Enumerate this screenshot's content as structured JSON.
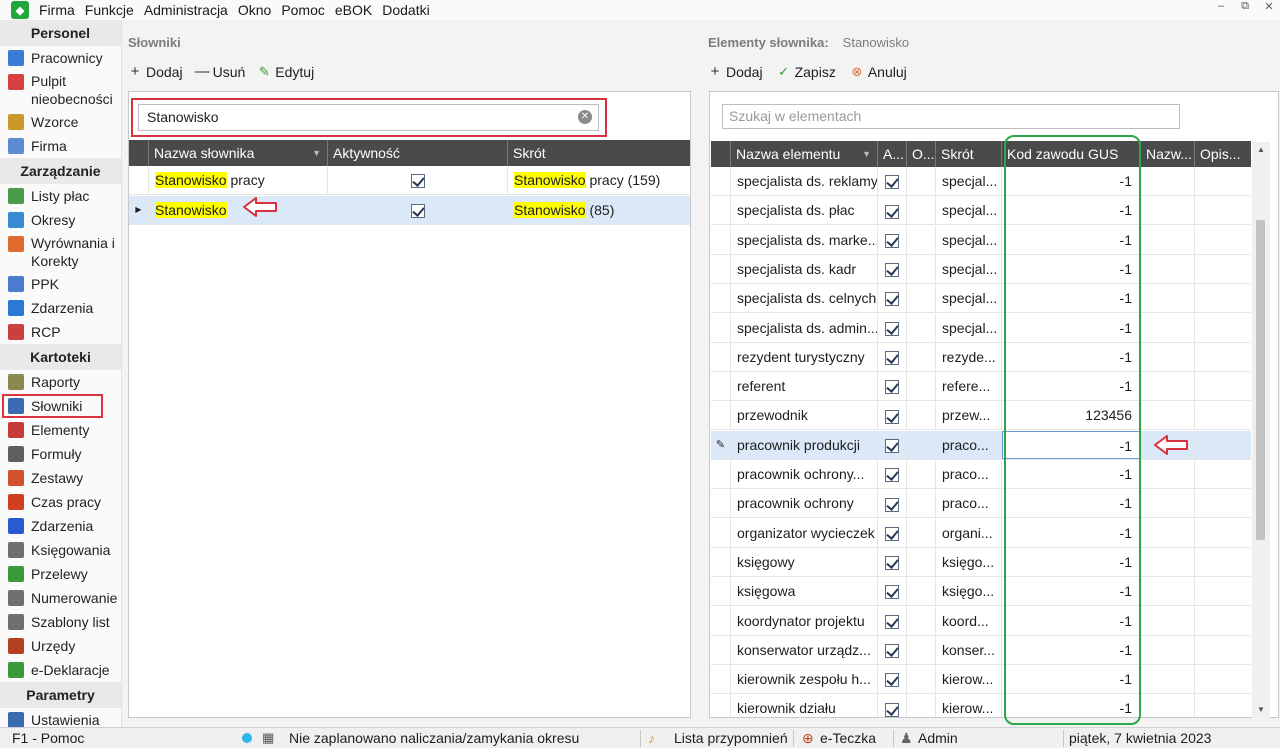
{
  "menu": [
    "Firma",
    "Funkcje",
    "Administracja",
    "Okno",
    "Pomoc",
    "eBOK",
    "Dodatki"
  ],
  "window_controls": [
    "‒",
    "⧉",
    "✕"
  ],
  "sidebar": {
    "sections": [
      {
        "title": "Personel",
        "items": [
          {
            "label": "Pracownicy",
            "icon": "user-icon",
            "color": "#3a7bd5"
          },
          {
            "label": "Pulpit nieobecności",
            "icon": "calendar-icon",
            "color": "#d94040",
            "two": true
          },
          {
            "label": "Wzorce",
            "icon": "template-icon",
            "color": "#c8982a"
          },
          {
            "label": "Firma",
            "icon": "document-icon",
            "color": "#5b8bd0"
          }
        ]
      },
      {
        "title": "Zarządzanie",
        "items": [
          {
            "label": "Listy płac",
            "icon": "payroll-icon",
            "color": "#4a9a4a"
          },
          {
            "label": "Okresy",
            "icon": "periods-icon",
            "color": "#3a8bd5"
          },
          {
            "label": "Wyrównania i Korekty",
            "icon": "corrections-icon",
            "color": "#e06a2a",
            "two": true
          },
          {
            "label": "PPK",
            "icon": "chart-icon",
            "color": "#4a7bd0"
          },
          {
            "label": "Zdarzenia",
            "icon": "globe-icon",
            "color": "#2a7ad5"
          },
          {
            "label": "RCP",
            "icon": "clock-card-icon",
            "color": "#c84040"
          }
        ]
      },
      {
        "title": "Kartoteki",
        "items": [
          {
            "label": "Raporty",
            "icon": "report-icon",
            "color": "#8a8a50"
          },
          {
            "label": "Słowniki",
            "icon": "dictionary-icon",
            "color": "#3a6ab0",
            "selected": true
          },
          {
            "label": "Elementy",
            "icon": "elements-icon",
            "color": "#c83a3a"
          },
          {
            "label": "Formuły",
            "icon": "sigma-icon",
            "color": "#606060"
          },
          {
            "label": "Zestawy",
            "icon": "sets-icon",
            "color": "#d05030"
          },
          {
            "label": "Czas pracy",
            "icon": "alarm-clock-icon",
            "color": "#d04020"
          },
          {
            "label": "Zdarzenia",
            "icon": "info-icon",
            "color": "#2a5ad0"
          },
          {
            "label": "Księgowania",
            "icon": "ledger-icon",
            "color": "#707070"
          },
          {
            "label": "Przelewy",
            "icon": "transfer-icon",
            "color": "#3a9a3a"
          },
          {
            "label": "Numerowanie",
            "icon": "numbering-icon",
            "color": "#707070"
          },
          {
            "label": "Szablony list",
            "icon": "list-template-icon",
            "color": "#707070"
          },
          {
            "label": "Urzędy",
            "icon": "building-icon",
            "color": "#b04020"
          },
          {
            "label": "e-Deklaracje",
            "icon": "e-declaration-icon",
            "color": "#3a9a3a"
          }
        ]
      },
      {
        "title": "Parametry",
        "items": [
          {
            "label": "Ustawienia",
            "icon": "settings-icon",
            "color": "#3a6ab0"
          }
        ]
      }
    ]
  },
  "left": {
    "title": "Słowniki",
    "toolbar": {
      "add": "Dodaj",
      "remove": "Usuń",
      "edit": "Edytuj"
    },
    "search_value": "Stanowisko",
    "headers": [
      "Nazwa słownika",
      "Aktywność",
      "Skrót"
    ],
    "rows": [
      {
        "name_hl": "Stanowisko",
        "name_rest": " pracy",
        "active": true,
        "abbr_hl": "Stanowisko",
        "abbr_rest": " pracy (159)",
        "selected": false
      },
      {
        "name_hl": "Stanowisko",
        "name_rest": "",
        "active": true,
        "abbr_hl": "Stanowisko",
        "abbr_rest": " (85)",
        "selected": true
      }
    ]
  },
  "right": {
    "title": "Elementy słownika:",
    "title_value": "Stanowisko",
    "toolbar": {
      "add": "Dodaj",
      "save": "Zapisz",
      "cancel": "Anuluj"
    },
    "search_placeholder": "Szukaj w elementach",
    "headers": [
      "Nazwa elementu",
      "A...",
      "O...",
      "Skrót",
      "Kod zawodu GUS",
      "Nazw...",
      "Opis..."
    ],
    "rows": [
      {
        "name": "specjalista ds. reklamy",
        "abbr": "specjal...",
        "gus": "-1"
      },
      {
        "name": "specjalista ds. płac",
        "abbr": "specjal...",
        "gus": "-1"
      },
      {
        "name": "specjalista ds. marke...",
        "abbr": "specjal...",
        "gus": "-1"
      },
      {
        "name": "specjalista ds. kadr",
        "abbr": "specjal...",
        "gus": "-1"
      },
      {
        "name": "specjalista ds. celnych",
        "abbr": "specjal...",
        "gus": "-1"
      },
      {
        "name": "specjalista ds. admin...",
        "abbr": "specjal...",
        "gus": "-1"
      },
      {
        "name": "rezydent turystyczny",
        "abbr": "rezyde...",
        "gus": "-1"
      },
      {
        "name": "referent",
        "abbr": "refere...",
        "gus": "-1"
      },
      {
        "name": "przewodnik",
        "abbr": "przew...",
        "gus": "123456"
      },
      {
        "name": "pracownik produkcji",
        "abbr": "praco...",
        "gus": "-1",
        "editing": true
      },
      {
        "name": "pracownik ochrony...",
        "abbr": "praco...",
        "gus": "-1"
      },
      {
        "name": "pracownik ochrony",
        "abbr": "praco...",
        "gus": "-1"
      },
      {
        "name": "organizator wycieczek",
        "abbr": "organi...",
        "gus": "-1"
      },
      {
        "name": "księgowy",
        "abbr": "księgo...",
        "gus": "-1"
      },
      {
        "name": "księgowa",
        "abbr": "księgo...",
        "gus": "-1"
      },
      {
        "name": "koordynator projektu",
        "abbr": "koord...",
        "gus": "-1"
      },
      {
        "name": "konserwator urządz...",
        "abbr": "konser...",
        "gus": "-1"
      },
      {
        "name": "kierownik zespołu h...",
        "abbr": "kierow...",
        "gus": "-1"
      },
      {
        "name": "kierownik działu",
        "abbr": "kierow...",
        "gus": "-1"
      }
    ]
  },
  "status": {
    "help": "F1 - Pomoc",
    "period": "Nie zaplanowano naliczania/zamykania okresu",
    "reminders": "Lista przypomnień",
    "eteczka": "e-Teczka",
    "user": "Admin",
    "date": "piątek, 7 kwietnia 2023"
  },
  "colors": {
    "highlight": "#ffff00",
    "red_annotation": "#d7323d",
    "green_annotation": "#2aa84a",
    "header_bg": "#4a4a4a",
    "selected_row": "#dae8f8"
  }
}
